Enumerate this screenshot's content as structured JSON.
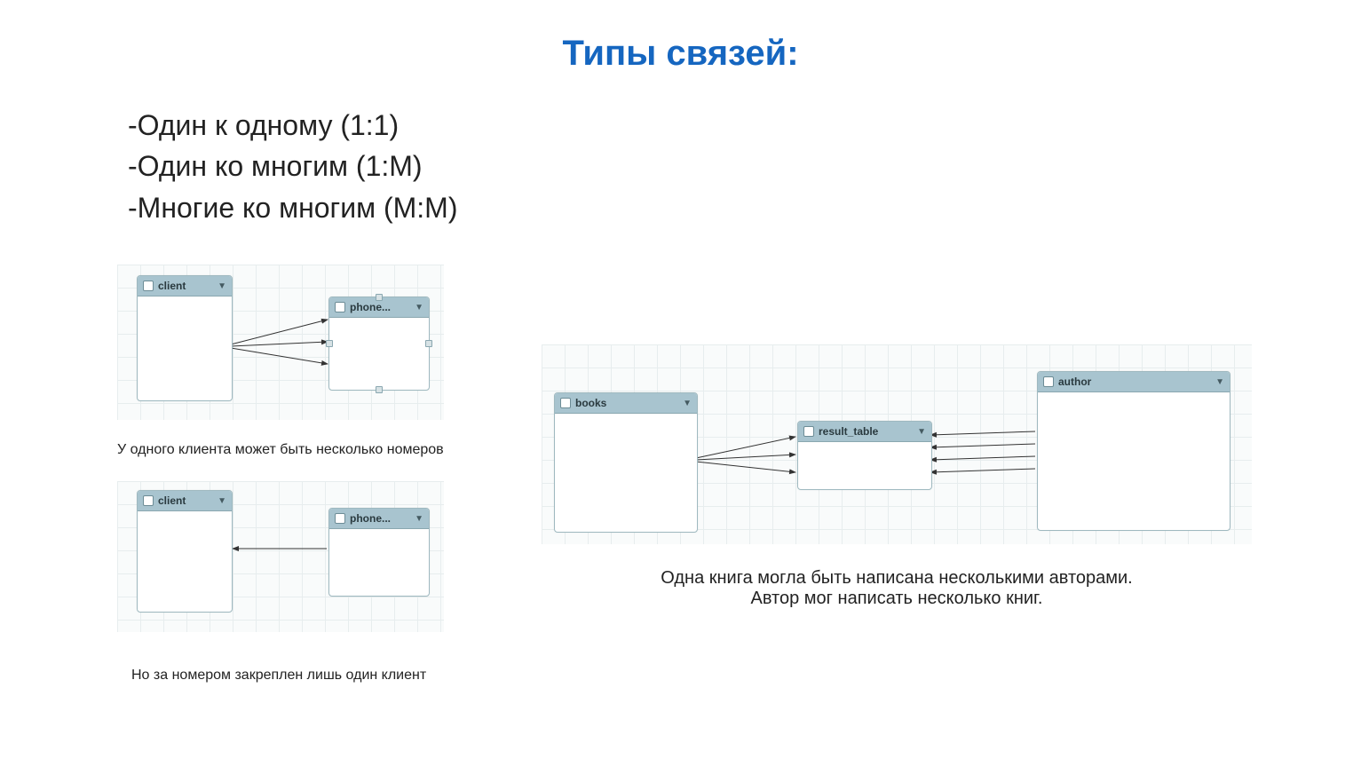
{
  "title": "Типы связей:",
  "bullets": {
    "b1": "-Один к одному (1:1)",
    "b2": "-Один ко многим (1:М)",
    "b3": "-Многие ко многим (М:М)"
  },
  "left_top": {
    "client_label": "client",
    "phone_label": "phone...",
    "caption": "У одного клиента может быть несколько номеров"
  },
  "left_bottom": {
    "client_label": "client",
    "phone_label": "phone...",
    "caption": "Но за номером закреплен лишь один клиент"
  },
  "right": {
    "books_label": "books",
    "result_label": "result_table",
    "author_label": "author",
    "caption_line1": "Одна книга могла быть написана несколькими авторами.",
    "caption_line2": "Автор мог написать несколько книг."
  }
}
